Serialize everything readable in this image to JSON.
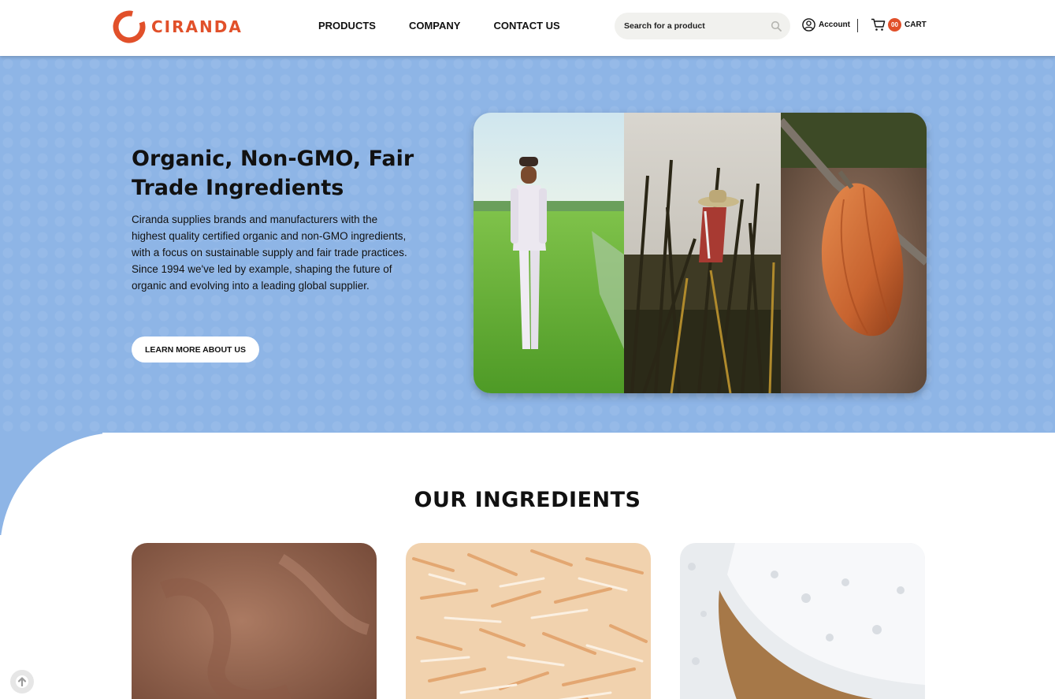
{
  "brand": {
    "name": "CIRANDA",
    "color": "#e1502a"
  },
  "nav": {
    "items": [
      "PRODUCTS",
      "COMPANY",
      "CONTACT US"
    ]
  },
  "search": {
    "placeholder": "Search for a product",
    "icon": "search-icon"
  },
  "account": {
    "label": "Account",
    "icon": "user-circle-icon"
  },
  "cart": {
    "count": "00",
    "label": "CART",
    "icon": "cart-icon"
  },
  "hero": {
    "title": "Organic, Non-GMO, Fair Trade Ingredients",
    "body": "Ciranda supplies brands and manufacturers with the highest quality certified organic and non-GMO ingredients, with a focus on sustainable supply and fair trade practices. Since 1994 we've led by example, shaping the future of organic and evolving into a leading global supplier.",
    "button": "LEARN MORE ABOUT US",
    "background": "#8eb5e6"
  },
  "ingredients": {
    "title": "OUR INGREDIENTS"
  },
  "back_to_top": {
    "icon": "arrow-up-circle-icon"
  }
}
